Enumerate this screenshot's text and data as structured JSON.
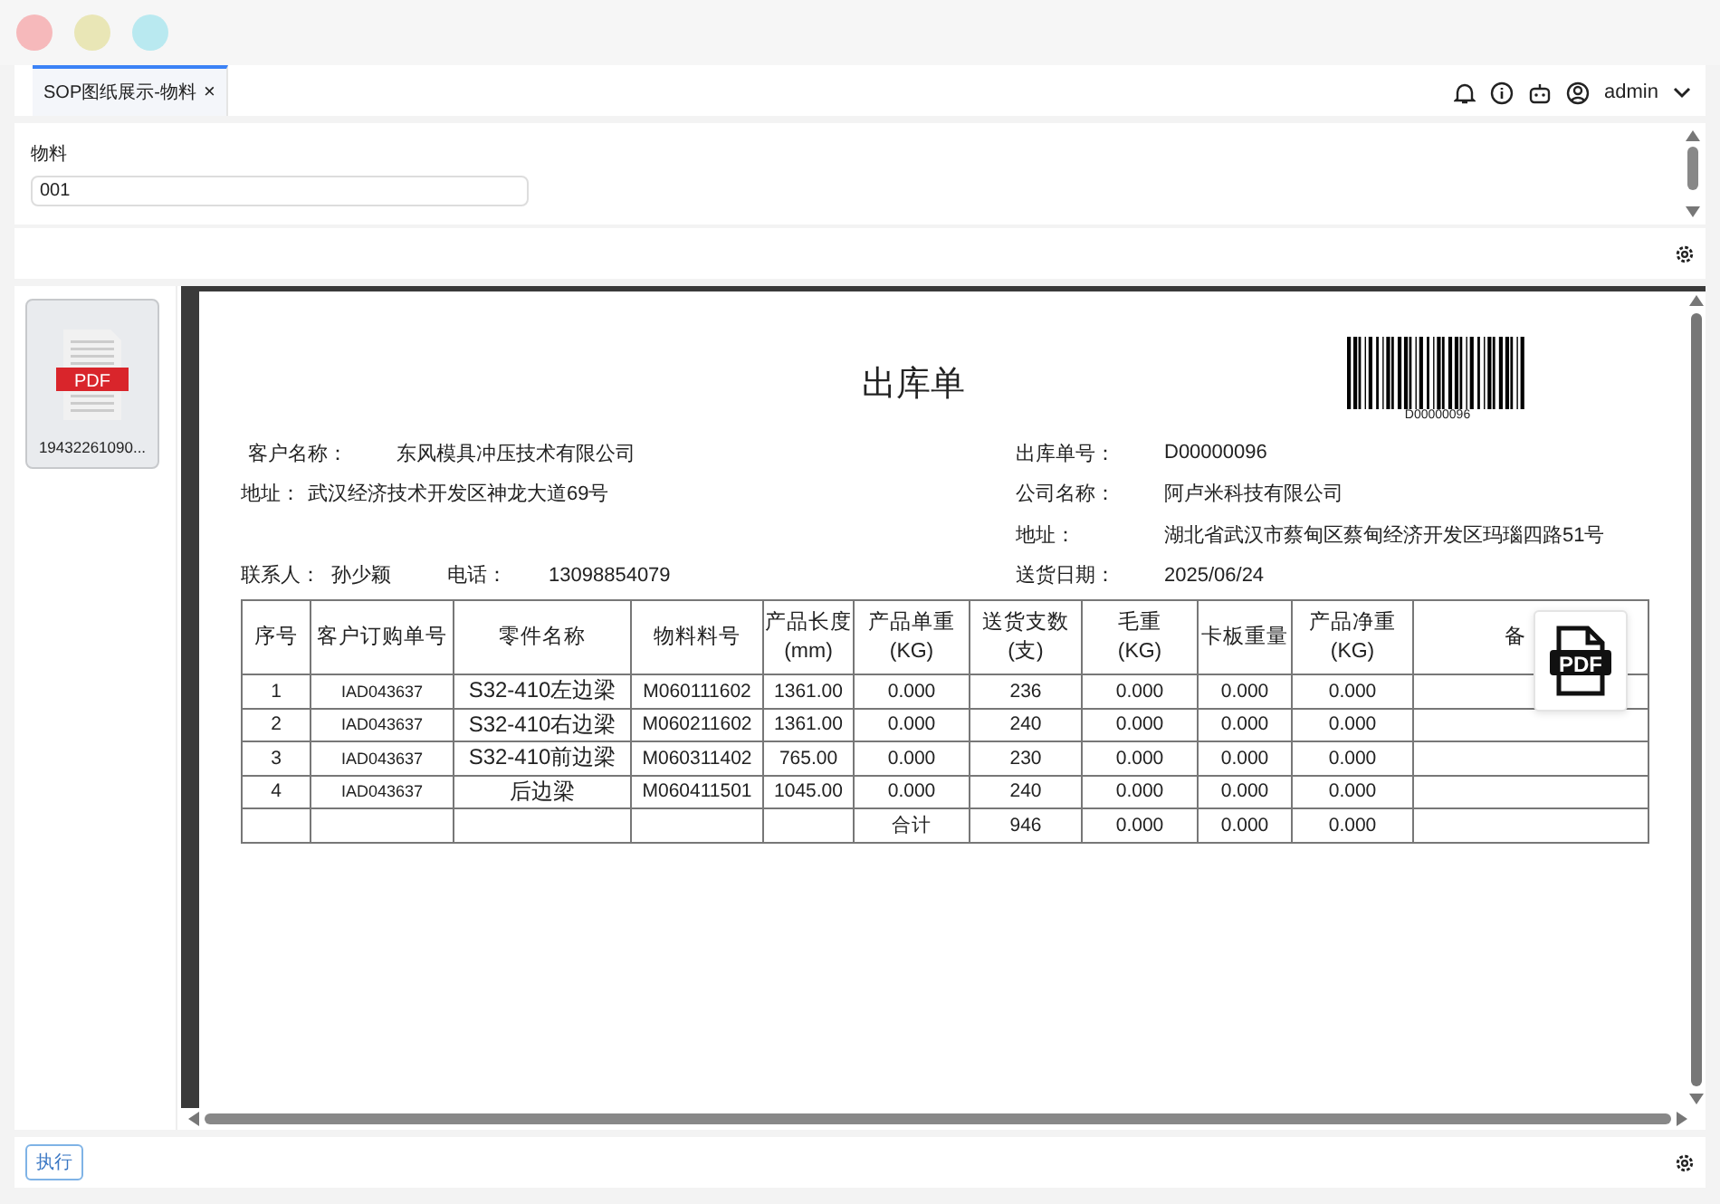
{
  "window_controls": [
    {
      "color": "#f6b9bb"
    },
    {
      "color": "#e9e6b6"
    },
    {
      "color": "#b9e9f0"
    }
  ],
  "tabs": [
    {
      "label": "SOP图纸展示-物料",
      "selected": true,
      "close": "×"
    }
  ],
  "user": {
    "name": "admin"
  },
  "form": {
    "label": "物料",
    "value": "001"
  },
  "files": [
    {
      "name": "19432261090...",
      "badge": "PDF"
    }
  ],
  "document": {
    "title": "出库单",
    "barcode": "D00000096",
    "customer_fields": [
      {
        "label": "客户名称：",
        "value": "东风模具冲压技术有限公司"
      },
      {
        "label": "地址：",
        "value": "武汉经济技术开发区神龙大道69号"
      }
    ],
    "contact": [
      {
        "label": "联系人：",
        "value": "孙少颖"
      },
      {
        "label": "电话：",
        "value": "13098854079"
      }
    ],
    "company_fields": [
      {
        "label": "出库单号：",
        "value": "D00000096"
      },
      {
        "label": "公司名称：",
        "value": "阿卢米科技有限公司"
      },
      {
        "label": "地址：",
        "value": "湖北省武汉市蔡甸区蔡甸经济开发区玛瑙四路51号"
      },
      {
        "label": "送货日期：",
        "value": "2025/06/24"
      }
    ],
    "table": {
      "columns": [
        "序号",
        "客户订购单号",
        "零件名称",
        "物料料号",
        "产品长度\n(mm)",
        "产品单重\n(KG)",
        "送货支数\n(支)",
        "毛重\n(KG)",
        "卡板重量",
        "产品净重\n(KG)",
        "备"
      ],
      "rows": [
        [
          "1",
          "IAD043637",
          "S32-410左边梁",
          "M060111602",
          "1361.00",
          "0.000",
          "236",
          "0.000",
          "0.000",
          "0.000",
          ""
        ],
        [
          "2",
          "IAD043637",
          "S32-410右边梁",
          "M060211602",
          "1361.00",
          "0.000",
          "240",
          "0.000",
          "0.000",
          "0.000",
          ""
        ],
        [
          "3",
          "IAD043637",
          "S32-410前边梁",
          "M060311402",
          "765.00",
          "0.000",
          "230",
          "0.000",
          "0.000",
          "0.000",
          ""
        ],
        [
          "4",
          "IAD043637",
          "后边梁",
          "M060411501",
          "1045.00",
          "0.000",
          "240",
          "0.000",
          "0.000",
          "0.000",
          ""
        ],
        [
          "",
          "",
          "",
          "",
          "",
          "合计",
          "946",
          "0.000",
          "0.000",
          "0.000",
          ""
        ]
      ]
    }
  },
  "pdf_button": {
    "label": "PDF"
  },
  "run_button": {
    "label": "执行"
  }
}
